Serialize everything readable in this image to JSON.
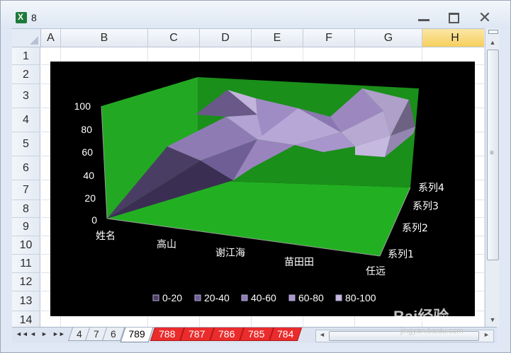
{
  "window": {
    "title": "8",
    "icon": "excel-icon",
    "controls": {
      "minimize": "minimize-icon",
      "maximize": "maximize-icon",
      "close": "✕"
    }
  },
  "sheet": {
    "columns": [
      "A",
      "B",
      "C",
      "D",
      "E",
      "F",
      "G",
      "H"
    ],
    "active_column": "H",
    "rows": [
      "1",
      "2",
      "3",
      "4",
      "5",
      "6",
      "7",
      "8",
      "9",
      "10",
      "11",
      "12",
      "13",
      "14"
    ]
  },
  "chart_data": {
    "type": "surface",
    "categories": [
      "姓名",
      "高山",
      "谢江海",
      "苗田田",
      "任远"
    ],
    "series": [
      {
        "name": "系列1"
      },
      {
        "name": "系列2"
      },
      {
        "name": "系列3"
      },
      {
        "name": "系列4"
      }
    ],
    "z_ticks": [
      "100",
      "80",
      "60",
      "40",
      "20",
      "0"
    ],
    "ylim": [
      0,
      100
    ],
    "legend": [
      "0-20",
      "20-40",
      "40-60",
      "60-80",
      "80-100"
    ],
    "legend_position": "bottom",
    "background": "#000000",
    "wall_color": "#1fa81f",
    "floor_color": "#23b023",
    "surface_color": "#a28cc7"
  },
  "tabs": {
    "nav": [
      "◄◄",
      "◄",
      "►",
      "►►"
    ],
    "items": [
      {
        "label": "4",
        "style": "normal"
      },
      {
        "label": "7",
        "style": "normal"
      },
      {
        "label": "6",
        "style": "normal"
      },
      {
        "label": "789",
        "style": "active"
      },
      {
        "label": "788",
        "style": "red"
      },
      {
        "label": "787",
        "style": "red"
      },
      {
        "label": "786",
        "style": "red"
      },
      {
        "label": "785",
        "style": "red"
      },
      {
        "label": "784",
        "style": "red"
      }
    ]
  },
  "watermark": {
    "text": "Bai经验",
    "sub": "jingyan.baidu.com"
  }
}
